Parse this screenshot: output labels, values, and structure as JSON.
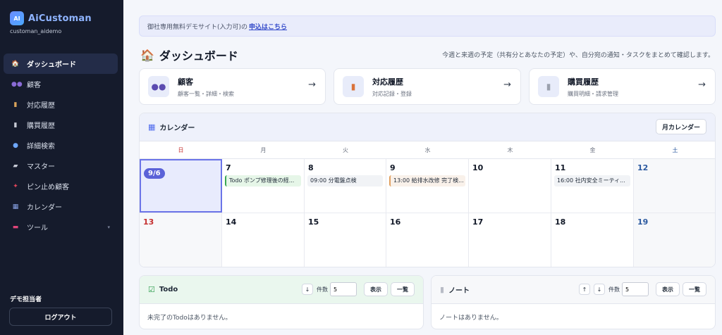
{
  "sidebar": {
    "logo_text": "AI",
    "brand": "AiCustoman",
    "tenant": "customan_aidemo",
    "items": [
      {
        "label": "ダッシュボード",
        "icon": "house-icon"
      },
      {
        "label": "顧客",
        "icon": "people-icon"
      },
      {
        "label": "対応履歴",
        "icon": "clipboard-icon"
      },
      {
        "label": "購買履歴",
        "icon": "receipt-icon"
      },
      {
        "label": "詳細検索",
        "icon": "search-icon"
      },
      {
        "label": "マスター",
        "icon": "tag-icon"
      },
      {
        "label": "ピン止め顧客",
        "icon": "pin-icon"
      },
      {
        "label": "カレンダー",
        "icon": "calendar-icon"
      },
      {
        "label": "ツール",
        "icon": "toolbox-icon"
      }
    ],
    "user": "デモ担当者",
    "logout": "ログアウト"
  },
  "banner": {
    "text": "御社専用無料デモサイト(入力可)の",
    "link": "申込はこちら"
  },
  "page": {
    "title": "ダッシュボード",
    "description": "今週と来週の予定（共有分とあなたの予定）や、自分宛の通知・タスクをまとめて確認します。"
  },
  "cards": [
    {
      "title": "顧客",
      "subtitle": "顧客一覧・詳細・検索",
      "icon": "people-icon"
    },
    {
      "title": "対応履歴",
      "subtitle": "対応記録・登録",
      "icon": "clipboard-icon"
    },
    {
      "title": "購買履歴",
      "subtitle": "購買明細・請求管理",
      "icon": "receipt-icon"
    }
  ],
  "calendar": {
    "title": "カレンダー",
    "month_button": "月カレンダー",
    "weekdays": [
      "日",
      "月",
      "火",
      "水",
      "木",
      "金",
      "土"
    ],
    "weeks": [
      [
        {
          "day": "9/6",
          "today": true
        },
        {
          "day": "7",
          "events": [
            {
              "text": "Todo ポンプ修理後の経...",
              "style": "green"
            }
          ]
        },
        {
          "day": "8",
          "events": [
            {
              "text": "09:00 分電盤点検",
              "style": "gray"
            }
          ]
        },
        {
          "day": "9",
          "events": [
            {
              "text": "13:00 給排水改修 完了検...",
              "style": "orange"
            }
          ]
        },
        {
          "day": "10"
        },
        {
          "day": "11",
          "events": [
            {
              "text": "16:00 社内安全ミーティ...",
              "style": "gray"
            }
          ]
        },
        {
          "day": "12"
        }
      ],
      [
        {
          "day": "13"
        },
        {
          "day": "14"
        },
        {
          "day": "15"
        },
        {
          "day": "16"
        },
        {
          "day": "17"
        },
        {
          "day": "18"
        },
        {
          "day": "19"
        }
      ]
    ]
  },
  "todo": {
    "title": "Todo",
    "count_label": "件数",
    "count_value": "5",
    "show_button": "表示",
    "list_button": "一覧",
    "empty": "未完了のTodoはありません。"
  },
  "note": {
    "title": "ノート",
    "count_label": "件数",
    "count_value": "5",
    "show_button": "表示",
    "list_button": "一覧",
    "empty": "ノートはありません。"
  }
}
